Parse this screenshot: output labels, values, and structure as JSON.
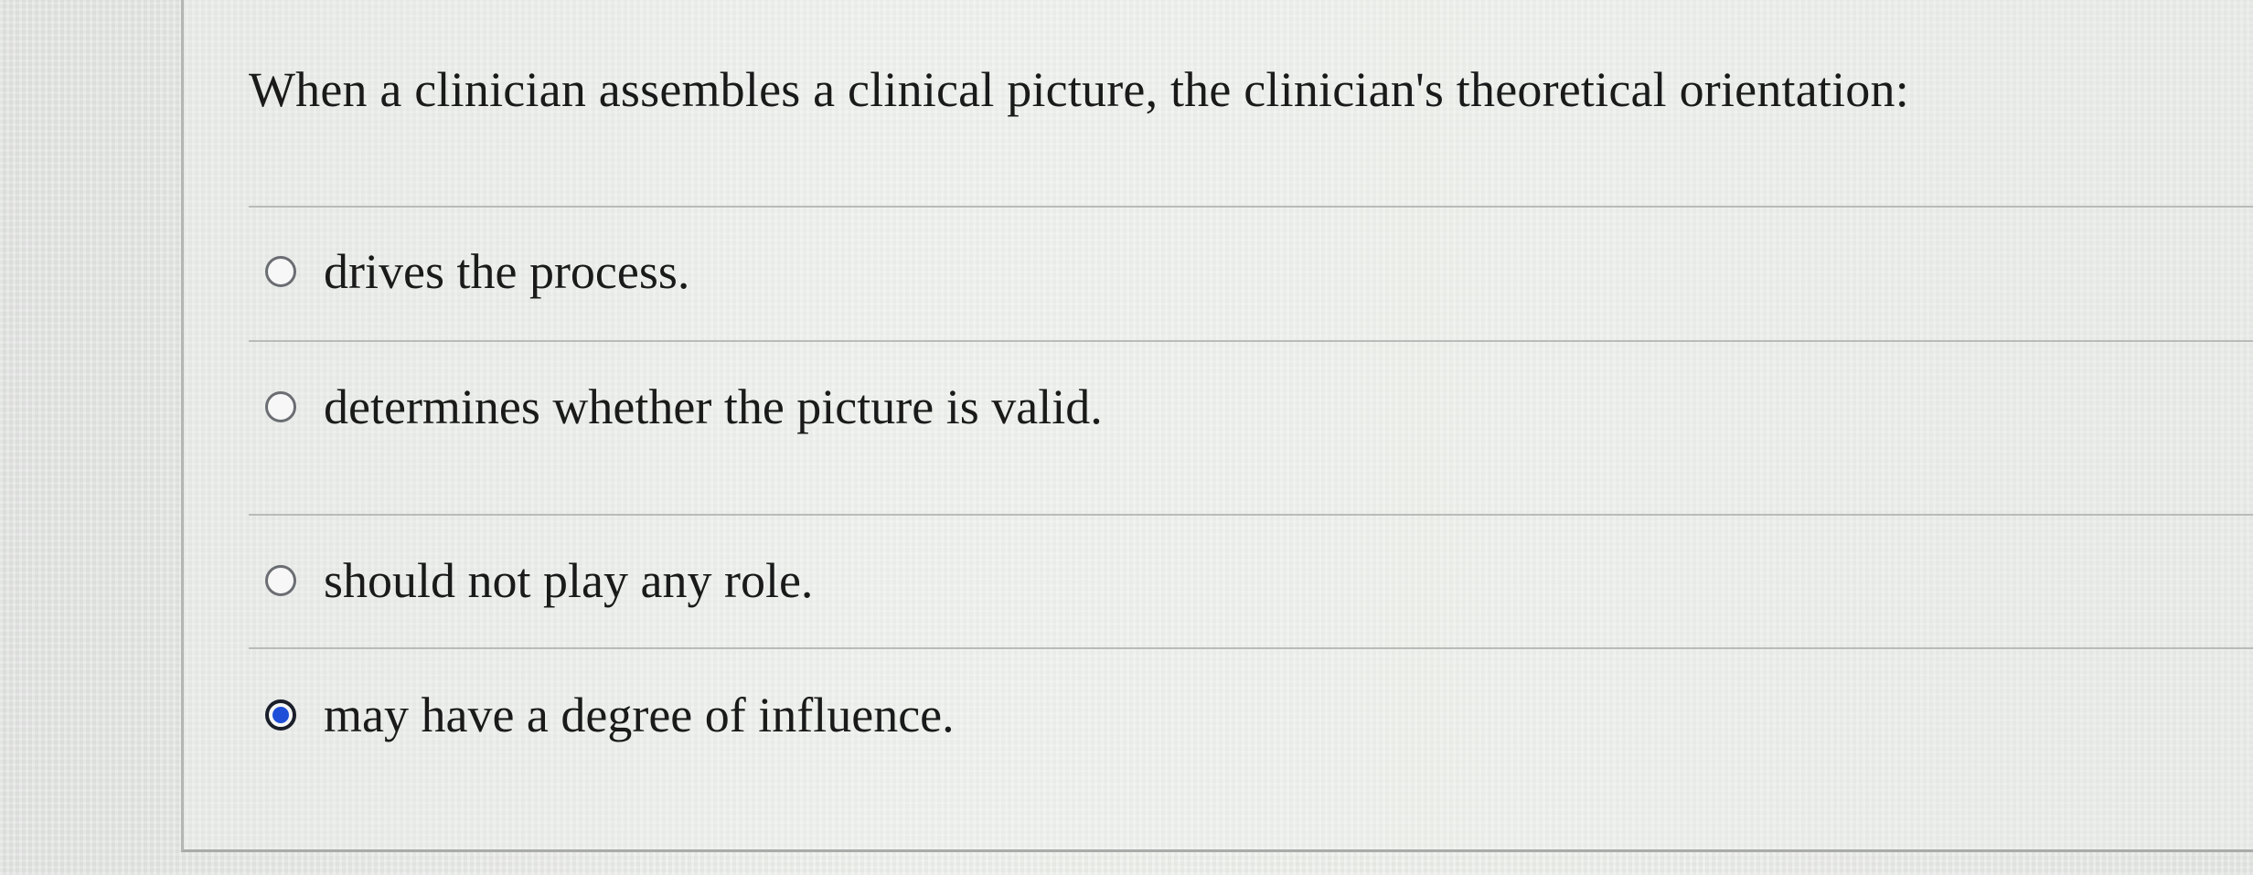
{
  "question": {
    "text": "When a clinician assembles a clinical picture, the clinician's theoretical orientation:"
  },
  "options": [
    {
      "label": "drives the process.",
      "selected": false
    },
    {
      "label": "determines whether the picture is valid.",
      "selected": false
    },
    {
      "label": "should not play any role.",
      "selected": false
    },
    {
      "label": "may have a degree of influence.",
      "selected": true
    }
  ],
  "colors": {
    "selected_radio": "#1f4fd8",
    "divider": "#b9bbb9",
    "background": "#e7e9e7"
  },
  "icons": {
    "unselected": "radio-unselected-icon",
    "selected": "radio-selected-icon"
  }
}
